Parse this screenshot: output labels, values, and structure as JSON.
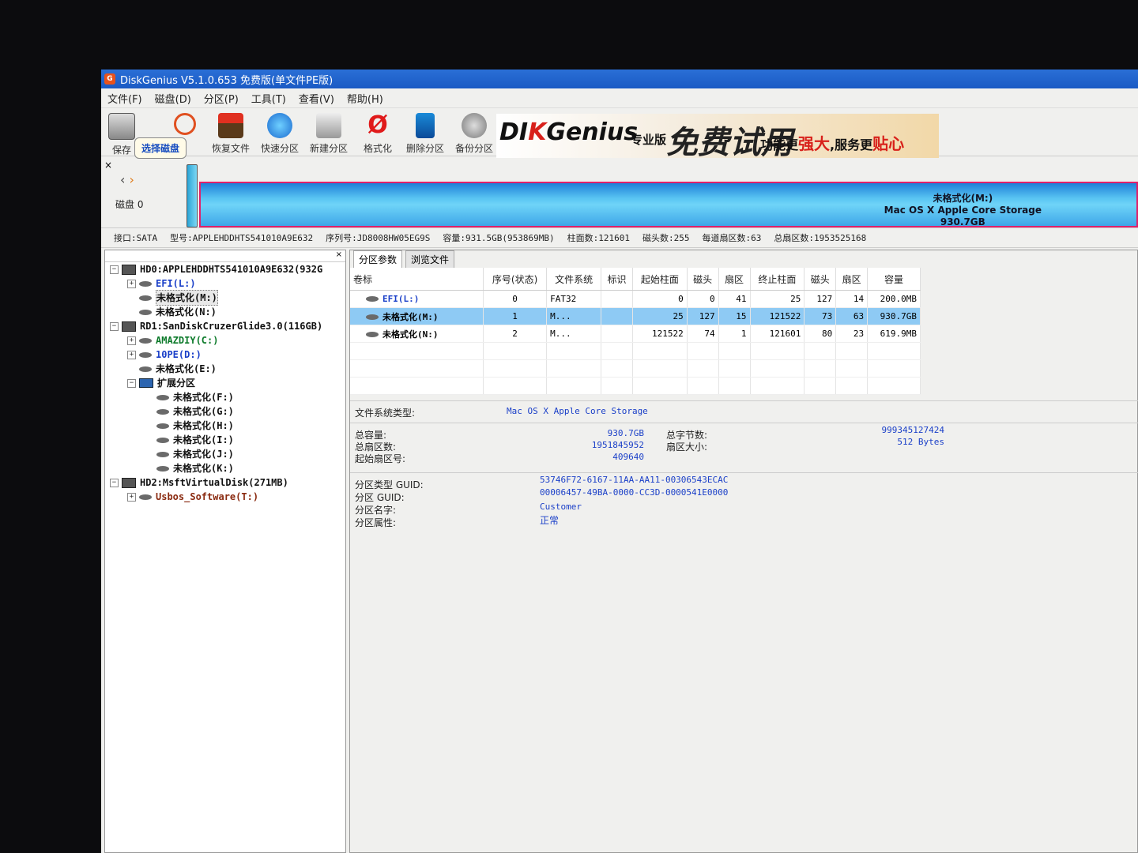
{
  "window": {
    "title": "DiskGenius V5.1.0.653 免费版(单文件PE版)",
    "app_icon_letter": "G"
  },
  "menu": [
    "文件(F)",
    "磁盘(D)",
    "分区(P)",
    "工具(T)",
    "查看(V)",
    "帮助(H)"
  ],
  "toolbar": {
    "items": [
      {
        "label": "保存",
        "icon": "save-disk-icon"
      },
      {
        "label": "恢复文件",
        "icon": "recover-file-icon"
      },
      {
        "label": "快速分区",
        "icon": "quick-partition-icon"
      },
      {
        "label": "新建分区",
        "icon": "new-partition-icon"
      },
      {
        "label": "格式化",
        "icon": "format-icon"
      },
      {
        "label": "删除分区",
        "icon": "delete-partition-icon"
      },
      {
        "label": "备份分区",
        "icon": "backup-partition-icon"
      }
    ],
    "tooltip": "选择磁盘"
  },
  "banner": {
    "logo_a": "DI",
    "logo_b": "K",
    "logo_c": "Genius",
    "edition": "专业版",
    "free_text": "免费试用",
    "slogan_a": "功能更",
    "slogan_b": "强大",
    "slogan_c": ",服务更",
    "slogan_d": "贴心"
  },
  "diskmap": {
    "nav_left": "‹",
    "nav_right": "›",
    "disk_label": "磁盘  0",
    "close": "×",
    "partition_name": "未格式化(M:)",
    "partition_fs": "Mac OS X Apple Core Storage",
    "partition_size": "930.7GB"
  },
  "disk_info": {
    "interface": "接口:SATA",
    "model": "型号:APPLEHDDHTS541010A9E632",
    "serial": "序列号:JD8008HW05EG9S",
    "capacity": "容量:931.5GB(953869MB)",
    "cylinders": "柱面数:121601",
    "heads": "磁头数:255",
    "sectors_per_track": "每道扇区数:63",
    "total_sectors": "总扇区数:1953525168"
  },
  "tree": {
    "close": "×",
    "nodes": [
      {
        "text": "HD0:APPLEHDDHTS541010A9E632(932G",
        "type": "hd",
        "level": 0,
        "toggle": "−",
        "style": "n-b"
      },
      {
        "text": "EFI(L:)",
        "type": "part",
        "level": 1,
        "toggle": "+",
        "style": "n-blue"
      },
      {
        "text": "未格式化(M:)",
        "type": "part",
        "level": 1,
        "toggle": "",
        "style": "n-b",
        "selected": true
      },
      {
        "text": "未格式化(N:)",
        "type": "part",
        "level": 1,
        "toggle": "",
        "style": "n-b"
      },
      {
        "text": "RD1:SanDiskCruzerGlide3.0(116GB)",
        "type": "hd",
        "level": 0,
        "toggle": "−",
        "style": "n-b"
      },
      {
        "text": "AMAZDIY(C:)",
        "type": "part",
        "level": 1,
        "toggle": "+",
        "style": "n-grn"
      },
      {
        "text": "10PE(D:)",
        "type": "part",
        "level": 1,
        "toggle": "+",
        "style": "n-blue"
      },
      {
        "text": "未格式化(E:)",
        "type": "part",
        "level": 1,
        "toggle": "",
        "style": "n-b"
      },
      {
        "text": "扩展分区",
        "type": "ext",
        "level": 1,
        "toggle": "−",
        "style": "n-b"
      },
      {
        "text": "未格式化(F:)",
        "type": "part",
        "level": 2,
        "toggle": "",
        "style": "n-b"
      },
      {
        "text": "未格式化(G:)",
        "type": "part",
        "level": 2,
        "toggle": "",
        "style": "n-b"
      },
      {
        "text": "未格式化(H:)",
        "type": "part",
        "level": 2,
        "toggle": "",
        "style": "n-b"
      },
      {
        "text": "未格式化(I:)",
        "type": "part",
        "level": 2,
        "toggle": "",
        "style": "n-b"
      },
      {
        "text": "未格式化(J:)",
        "type": "part",
        "level": 2,
        "toggle": "",
        "style": "n-b"
      },
      {
        "text": "未格式化(K:)",
        "type": "part",
        "level": 2,
        "toggle": "",
        "style": "n-b"
      },
      {
        "text": "HD2:MsftVirtualDisk(271MB)",
        "type": "hd",
        "level": 0,
        "toggle": "−",
        "style": "n-b"
      },
      {
        "text": "Usbos_Software(T:)",
        "type": "part",
        "level": 1,
        "toggle": "+",
        "style": "n-brn"
      }
    ]
  },
  "tabs": [
    "分区参数",
    "浏览文件"
  ],
  "partition_table": {
    "headers": [
      "卷标",
      "序号(状态)",
      "文件系统",
      "标识",
      "起始柱面",
      "磁头",
      "扇区",
      "终止柱面",
      "磁头",
      "扇区",
      "容量"
    ],
    "rows": [
      {
        "cells": [
          "EFI(L:)",
          "0",
          "FAT32",
          "",
          "0",
          "0",
          "41",
          "25",
          "127",
          "14",
          "200.0MB"
        ],
        "highlight": false,
        "blue": true
      },
      {
        "cells": [
          "未格式化(M:)",
          "1",
          "M...",
          "",
          "25",
          "127",
          "15",
          "121522",
          "73",
          "63",
          "930.7GB"
        ],
        "highlight": true,
        "blue": false
      },
      {
        "cells": [
          "未格式化(N:)",
          "2",
          "M...",
          "",
          "121522",
          "74",
          "1",
          "121601",
          "80",
          "23",
          "619.9MB"
        ],
        "highlight": false,
        "blue": false
      }
    ]
  },
  "details": {
    "fs_type_label": "文件系统类型:",
    "fs_type_value": "Mac OS X Apple Core Storage",
    "total_capacity_label": "总容量:",
    "total_capacity_value": "930.7GB",
    "total_sectors_label": "总扇区数:",
    "total_sectors_value": "1951845952",
    "start_sector_label": "起始扇区号:",
    "start_sector_value": "409640",
    "total_bytes_label": "总字节数:",
    "total_bytes_value": "999345127424",
    "sector_size_label": "扇区大小:",
    "sector_size_value": "512 Bytes",
    "part_type_guid_label": "分区类型 GUID:",
    "part_type_guid_value": "53746F72-6167-11AA-AA11-00306543ECAC",
    "part_guid_label": "分区 GUID:",
    "part_guid_value": "00006457-49BA-0000-CC3D-0000541E0000",
    "part_name_label": "分区名字:",
    "part_name_value": "Customer",
    "part_attr_label": "分区属性:",
    "part_attr_value": "正常"
  }
}
